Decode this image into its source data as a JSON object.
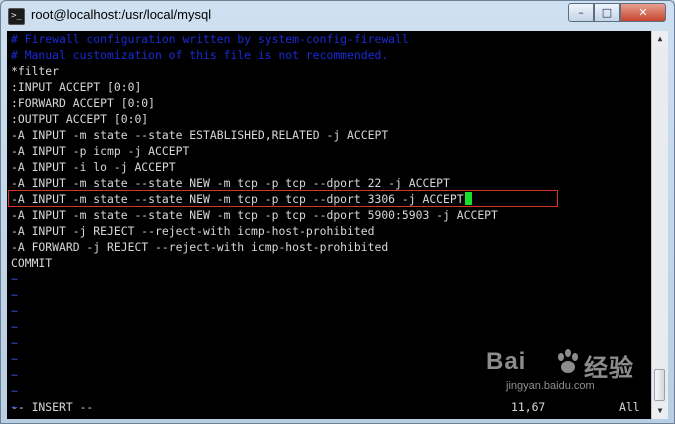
{
  "window": {
    "title": "root@localhost:/usr/local/mysql",
    "app_icon_glyph": ">_",
    "controls": {
      "minimize": "–",
      "maximize": "□",
      "close": "✕"
    }
  },
  "terminal": {
    "lines": [
      "# Firewall configuration written by system-config-firewall",
      "# Manual customization of this file is not recommended.",
      "*filter",
      ":INPUT ACCEPT [0:0]",
      ":FORWARD ACCEPT [0:0]",
      ":OUTPUT ACCEPT [0:0]",
      "-A INPUT -m state --state ESTABLISHED,RELATED -j ACCEPT",
      "-A INPUT -p icmp -j ACCEPT",
      "-A INPUT -i lo -j ACCEPT",
      "-A INPUT -m state --state NEW -m tcp -p tcp --dport 22 -j ACCEPT",
      "-A INPUT -m state --state NEW -m tcp -p tcp --dport 3306 -j ACCEPT",
      "-A INPUT -m state --state NEW -m tcp -p tcp --dport 5900:5903 -j ACCEPT",
      "-A INPUT -j REJECT --reject-with icmp-host-prohibited",
      "-A FORWARD -j REJECT --reject-with icmp-host-prohibited",
      "COMMIT",
      "~",
      "~",
      "~",
      "~",
      "~",
      "~",
      "~",
      "~",
      "~"
    ],
    "status_mode": "-- INSERT --",
    "status_position": "11,67",
    "status_scroll": "All",
    "colors": {
      "background": "#000000",
      "text": "#d8d8d8",
      "comment": "#1a2bd8",
      "cursor": "#17e02d",
      "highlight_border": "#d8342a"
    }
  },
  "scrollbar": {
    "up_glyph": "▲",
    "down_glyph": "▼"
  },
  "watermark": {
    "brand_left": "Bai",
    "brand_right": "经验",
    "url": "jingyan.baidu.com"
  }
}
